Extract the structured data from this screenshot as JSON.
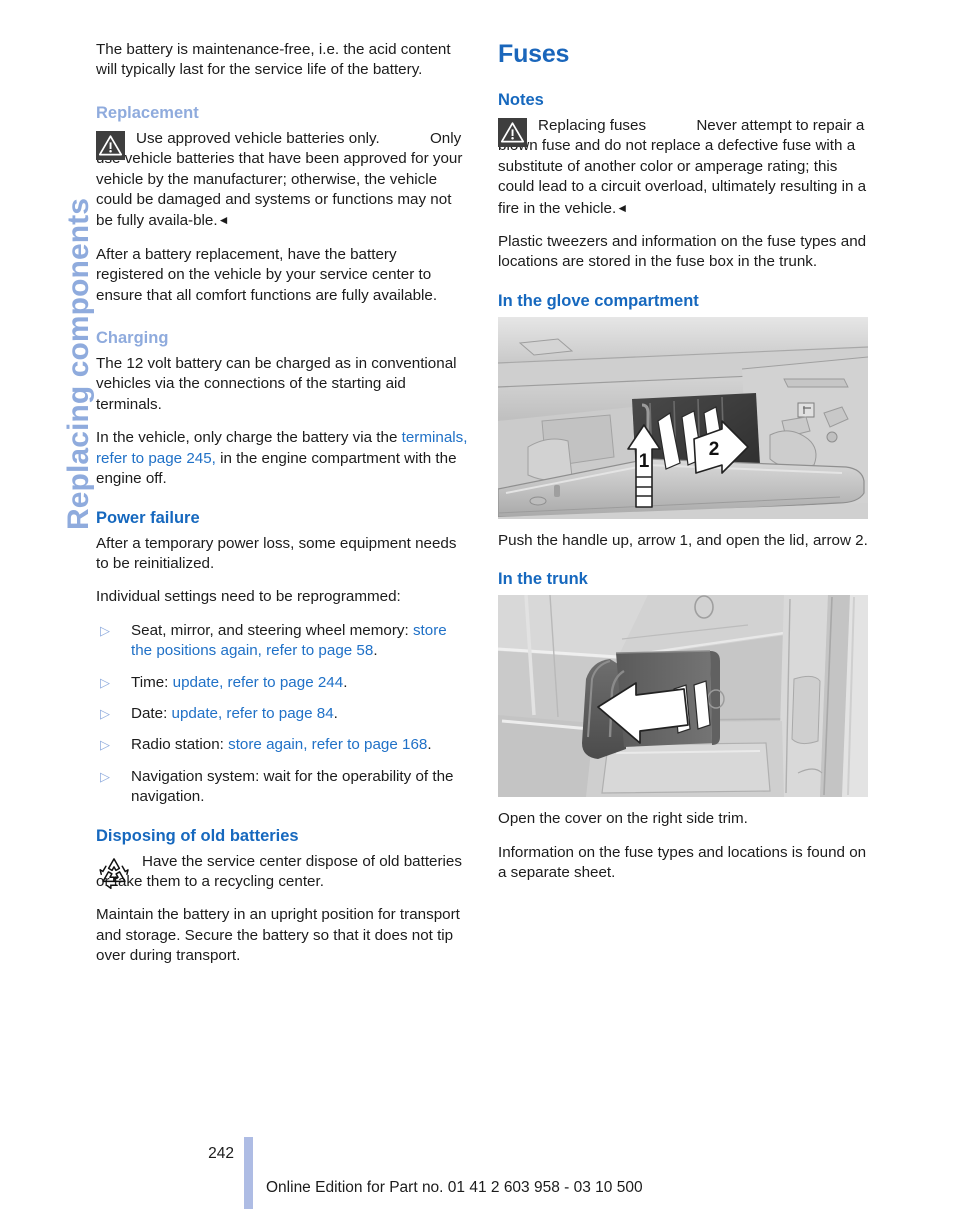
{
  "chapter": {
    "tab_label": "Replacing components"
  },
  "left_column": {
    "intro_paragraph": "The battery is maintenance-free, i.e. the acid content will typically last for the service life of the battery.",
    "replacement": {
      "heading": "Replacement",
      "warning_icon": "warning-triangle-icon",
      "warning_title": "Use approved vehicle batteries only.",
      "warning_body": "Only use vehicle batteries that have been approved for your vehicle by the manufacturer; otherwise, the vehicle could be damaged and systems or functions may not be fully availa-ble.",
      "end_mark": "◄",
      "paragraph": "After a battery replacement, have the battery registered on the vehicle by your service center to ensure that all comfort functions are fully available."
    },
    "charging": {
      "heading": "Charging",
      "paragraph_1": "The 12 volt battery can be charged as in conventional vehicles via the connections of the starting aid terminals.",
      "paragraph_2_pre": "In the vehicle, only charge the battery via the ",
      "paragraph_2_link": "terminals, refer to page 245,",
      "paragraph_2_post": " in the engine compartment with the engine off."
    },
    "power_failure": {
      "heading": "Power failure",
      "paragraph_1": "After a temporary power loss, some equipment needs to be reinitialized.",
      "paragraph_2": "Individual settings need to be reprogrammed:",
      "bullet_marker": "▷",
      "bullets": [
        {
          "pre": "Seat, mirror, and steering wheel memory: ",
          "link": "store the positions again, refer to page 58",
          "post": "."
        },
        {
          "pre": "Time: ",
          "link": "update, refer to page 244",
          "post": "."
        },
        {
          "pre": "Date: ",
          "link": "update, refer to page 84",
          "post": "."
        },
        {
          "pre": "Radio station: ",
          "link": "store again, refer to page 168",
          "post": "."
        },
        {
          "pre": "Navigation system: wait for the operability of the navigation.",
          "link": "",
          "post": ""
        }
      ]
    },
    "disposing": {
      "heading": "Disposing of old batteries",
      "recycle_icon": "recycling-symbol-icon",
      "note": "Have the service center dispose of old batteries or take them to a recycling center.",
      "paragraph": "Maintain the battery in an upright position for transport and storage. Secure the battery so that it does not tip over during transport."
    }
  },
  "right_column": {
    "title": "Fuses",
    "notes": {
      "heading": "Notes",
      "warning_icon": "warning-triangle-icon",
      "warning_title": "Replacing fuses",
      "warning_body": "Never attempt to repair a blown fuse and do not replace a defective fuse with a substitute of another color or amperage rating; this could lead to a circuit overload, ultimately resulting in a fire in the vehicle.",
      "end_mark": "◄",
      "paragraph": "Plastic tweezers and information on the fuse types and locations are stored in the fuse box in the trunk."
    },
    "glove_compartment": {
      "heading": "In the glove compartment",
      "figure_name": "glove-compartment-illustration",
      "arrow_1_label": "1",
      "arrow_2_label": "2",
      "caption": "Push the handle up, arrow 1, and open the lid, arrow 2."
    },
    "trunk": {
      "heading": "In the trunk",
      "figure_name": "trunk-side-trim-illustration",
      "caption_1": "Open the cover on the right side trim.",
      "caption_2": "Information on the fuse types and locations is found on a separate sheet."
    }
  },
  "footer": {
    "page_number": "242",
    "note": "Online Edition for Part no. 01 41 2 603 958 - 03 10 500"
  },
  "colors": {
    "heading_blue": "#1668be",
    "subheading_blue": "#8fabdd",
    "link_blue": "#2071c7",
    "rule_blue": "#aebce4",
    "warning_box": "#3e3e3e"
  }
}
